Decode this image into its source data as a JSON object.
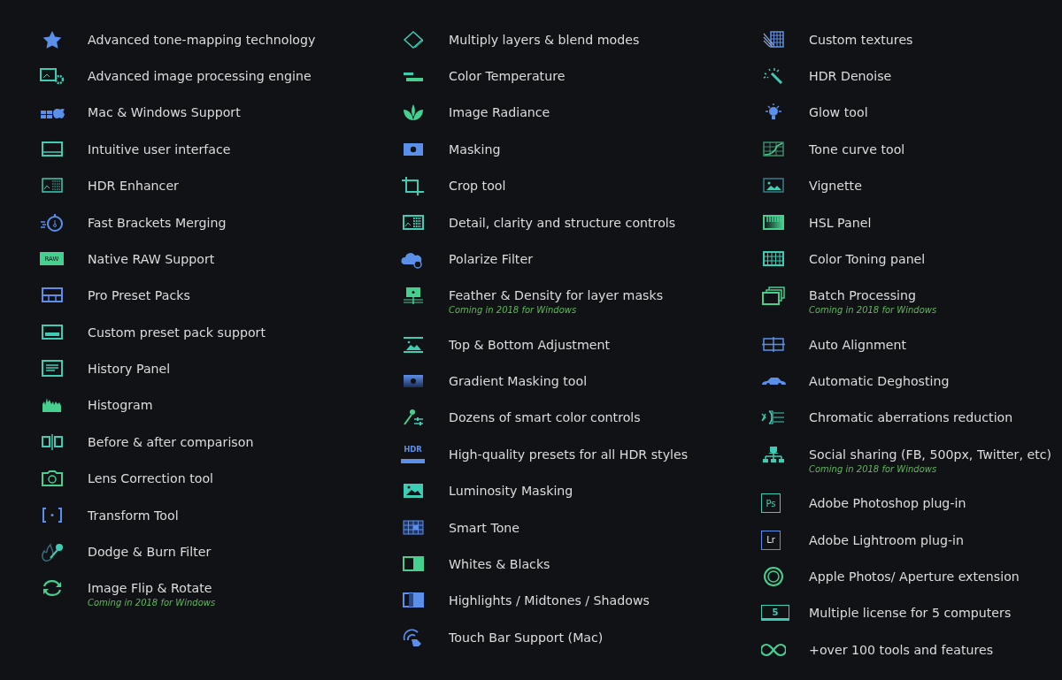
{
  "columns": [
    {
      "items": [
        {
          "title": "Advanced tone-mapping technology"
        },
        {
          "title": "Advanced image processing engine"
        },
        {
          "title": "Mac & Windows Support"
        },
        {
          "title": "Intuitive user interface"
        },
        {
          "title": "HDR Enhancer"
        },
        {
          "title": "Fast Brackets Merging"
        },
        {
          "title": "Native RAW Support",
          "icon_label": "RAW"
        },
        {
          "title": "Pro Preset Packs"
        },
        {
          "title": "Custom preset pack support"
        },
        {
          "title": "History Panel"
        },
        {
          "title": "Histogram"
        },
        {
          "title": "Before & after comparison"
        },
        {
          "title": "Lens Correction tool"
        },
        {
          "title": "Transform Tool"
        },
        {
          "title": "Dodge & Burn Filter"
        },
        {
          "title": "Image Flip & Rotate",
          "note": "Coming in 2018 for Windows"
        }
      ]
    },
    {
      "items": [
        {
          "title": "Multiply layers & blend modes"
        },
        {
          "title": "Color Temperature"
        },
        {
          "title": "Image Radiance"
        },
        {
          "title": "Masking"
        },
        {
          "title": "Crop tool"
        },
        {
          "title": "Detail, clarity and structure controls"
        },
        {
          "title": "Polarize Filter"
        },
        {
          "title": "Feather & Density for layer masks",
          "note": "Coming in 2018 for Windows"
        },
        {
          "title": "Top & Bottom Adjustment"
        },
        {
          "title": "Gradient Masking tool"
        },
        {
          "title": "Dozens of smart color controls"
        },
        {
          "title": "High-quality presets for all HDR styles",
          "icon_label": "HDR"
        },
        {
          "title": "Luminosity Masking"
        },
        {
          "title": "Smart Tone"
        },
        {
          "title": "Whites & Blacks"
        },
        {
          "title": "Highlights / Midtones / Shadows"
        },
        {
          "title": "Touch Bar Support (Mac)"
        }
      ]
    },
    {
      "items": [
        {
          "title": "Custom textures"
        },
        {
          "title": "HDR Denoise"
        },
        {
          "title": "Glow tool"
        },
        {
          "title": "Tone curve tool"
        },
        {
          "title": "Vignette"
        },
        {
          "title": "HSL Panel"
        },
        {
          "title": "Color Toning panel"
        },
        {
          "title": "Batch Processing",
          "note": "Coming in 2018 for Windows"
        },
        {
          "title": "Auto Alignment"
        },
        {
          "title": "Automatic Deghosting"
        },
        {
          "title": "Chromatic aberrations reduction"
        },
        {
          "title": "Social sharing (FB, 500px, Twitter, etc)",
          "note": "Coming in 2018 for Windows"
        },
        {
          "title": "Adobe Photoshop plug-in",
          "icon_label": "Ps"
        },
        {
          "title": "Adobe Lightroom plug-in",
          "icon_label": "Lr"
        },
        {
          "title": "Apple Photos/ Aperture extension"
        },
        {
          "title": "Multiple license for 5 computers",
          "icon_label": "5"
        },
        {
          "title": "+over 100 tools and features"
        }
      ]
    }
  ]
}
